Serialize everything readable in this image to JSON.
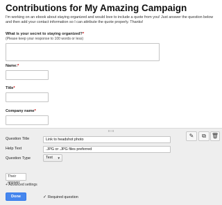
{
  "form": {
    "title": "Contributions for My Amazing Campaign",
    "description": "I'm working on an ebook about staying organized and would love to include a quote from you! Just answer the question below and then add your contact information so I can attribute the quote properly. Thanks!"
  },
  "questions": [
    {
      "label": "What is your secret to staying organized?",
      "required_mark": "*",
      "help": "(Please keep your response to 100 words or less)"
    },
    {
      "label": "Name:",
      "required_mark": "*"
    },
    {
      "label": "Title",
      "required_mark": "*"
    },
    {
      "label": "Company name",
      "required_mark": "*"
    }
  ],
  "editor": {
    "toolbar": [
      "pencil-icon",
      "copy-icon",
      "trash-icon"
    ],
    "question_title_label": "Question Title",
    "question_title_value": "Link to headshot photo",
    "help_text_label": "Help Text",
    "help_text_value": ".JPG or .JPG files preferred",
    "question_type_label": "Question Type",
    "question_type_value": "Text",
    "preview_placeholder": "Their answer",
    "advanced_settings": "+ Advanced settings",
    "done_label": "Done",
    "required_label": "Required question",
    "required_checked": true
  },
  "colors": {
    "done_button": "#4787ed",
    "required_asterisk": "#cc0000",
    "panel_bg": "#eeeeee"
  }
}
